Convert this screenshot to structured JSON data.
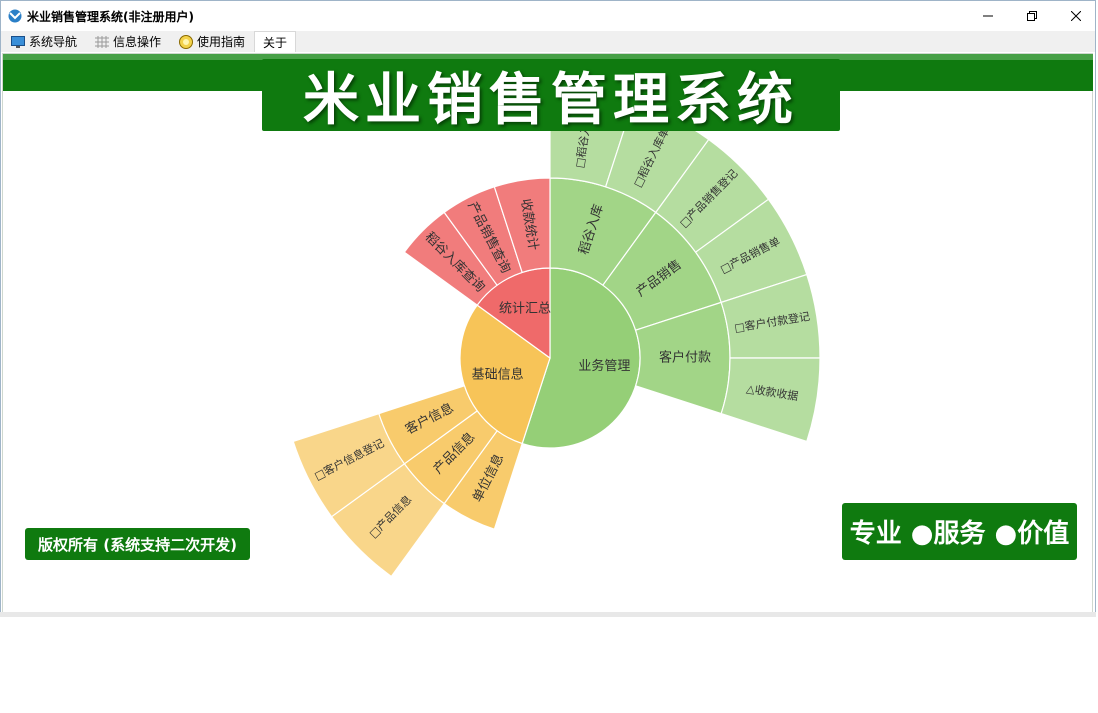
{
  "window": {
    "title": "米业销售管理系统(非注册用户)"
  },
  "menu": {
    "items": [
      {
        "label": "系统导航",
        "icon": "monitor-icon"
      },
      {
        "label": "信息操作",
        "icon": "grid-icon"
      },
      {
        "label": "使用指南",
        "icon": "help-icon"
      },
      {
        "label": "关于"
      }
    ]
  },
  "banner": {
    "title": "米业销售管理系统"
  },
  "footer": {
    "copyright": "版权所有 (系统支持二次开发)",
    "slogan": "专业 ●服务 ●价值"
  },
  "colors": {
    "brand_green": "#0f7a0f",
    "seg_green": "#95cf77",
    "seg_red": "#ef6a6a",
    "seg_orange": "#f7c458"
  },
  "chart_data": {
    "type": "sunburst",
    "root": [
      {
        "name": "业务管理",
        "value": 11,
        "color": "#95cf77",
        "children": [
          {
            "name": "稻谷入库",
            "value": 2,
            "children": [
              {
                "name": "□稻谷入库记",
                "value": 1
              },
              {
                "name": "□稻谷入库单",
                "value": 1
              }
            ]
          },
          {
            "name": "产品销售",
            "value": 2,
            "children": [
              {
                "name": "□产品销售登记",
                "value": 1
              },
              {
                "name": "□产品销售单",
                "value": 1
              }
            ]
          },
          {
            "name": "客户付款",
            "value": 2,
            "children": [
              {
                "name": "□客户付款登记",
                "value": 1
              },
              {
                "name": "△收款收据",
                "value": 1
              }
            ]
          }
        ]
      },
      {
        "name": "基础信息",
        "value": 6,
        "color": "#f7c458",
        "children": [
          {
            "name": "单位信息",
            "value": 1
          },
          {
            "name": "产品信息",
            "value": 1,
            "children": [
              {
                "name": "□产品信息",
                "value": 1
              }
            ]
          },
          {
            "name": "客户信息",
            "value": 1,
            "children": [
              {
                "name": "□客户信息登记",
                "value": 1
              }
            ]
          }
        ]
      },
      {
        "name": "统计汇总",
        "value": 3,
        "color": "#ef6a6a",
        "children": [
          {
            "name": "稻谷入库查询",
            "value": 1
          },
          {
            "name": "产品销售查询",
            "value": 1
          },
          {
            "name": "收款统计",
            "value": 1
          }
        ]
      }
    ]
  }
}
